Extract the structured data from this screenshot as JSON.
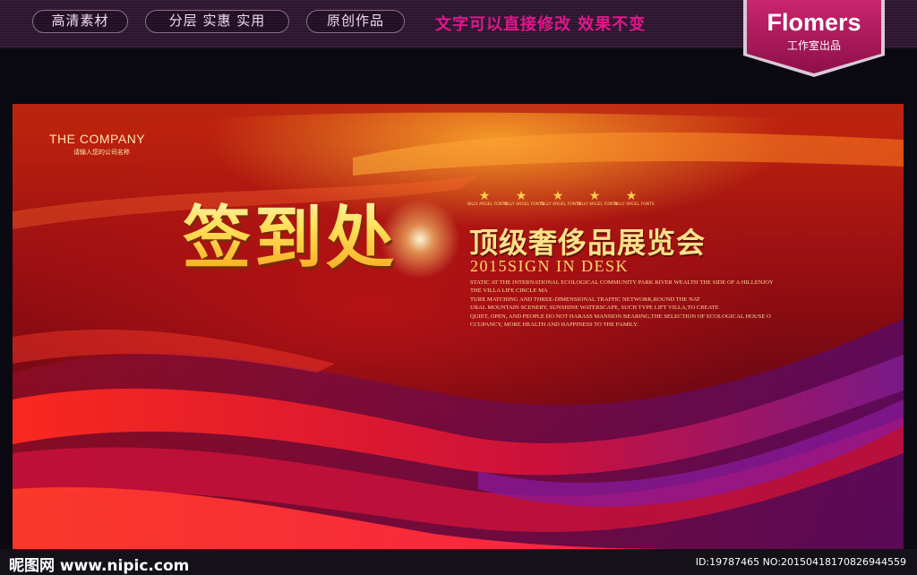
{
  "header": {
    "pills": [
      "高清素材",
      "分层 实惠 实用",
      "原创作品"
    ],
    "slogan": "文字可以直接修改  效果不变",
    "brand": {
      "name": "Flomers",
      "sub": "工作室出品"
    },
    "colors": {
      "slogan": "#e0178b",
      "brand_bg": "#b0195e"
    }
  },
  "banner": {
    "company": "THE COMPANY",
    "company_sub": "请输入您的公司名称",
    "title": "签到处",
    "stars": [
      {
        "icon": "star-icon",
        "label": "BILLY ARGEL FONTS"
      },
      {
        "icon": "star-icon",
        "label": "BILLY ARGEL FONTS"
      },
      {
        "icon": "star-icon",
        "label": "BILLY ARGEL FONTS"
      },
      {
        "icon": "star-icon",
        "label": "BILLY ARGEL FONTS"
      },
      {
        "icon": "star-icon",
        "label": "BILLY ARGEL FONTS"
      }
    ],
    "subtitle": "顶级奢侈品展览会",
    "desk": "2015SIGN IN DESK",
    "description": [
      "STATIC AT THE INTERNATIONAL ECOLOGICAL COMMUNITY PARK RIVER WEALTH THE SIDE OF A HILLENJOY",
      "THE VILLA LIFE CIRCLE MA",
      "TURE MATCHING AND THREE-DIMENSIONAL TRAFFIC NETWORK,ROUND THE NAT",
      "URAL MOUNTAIN SCENERY, SUNSHINE WATERSCAPE, SUCH TYPE LIFT VILLA,TO CREATE",
      "QUIET, OPEN, AND PEOPLE DO NOT HARASS MANSION BEARING,THE SELECTION OF ECOLOGICAL HOUSE O",
      "CCUPANCY, MORE HEALTH AND HAPPINESS TO THE FAMILY."
    ]
  },
  "footer": {
    "site": "昵图网 www.nipic.com",
    "image_id": "ID:19787465 NO:20150418170826944559"
  }
}
